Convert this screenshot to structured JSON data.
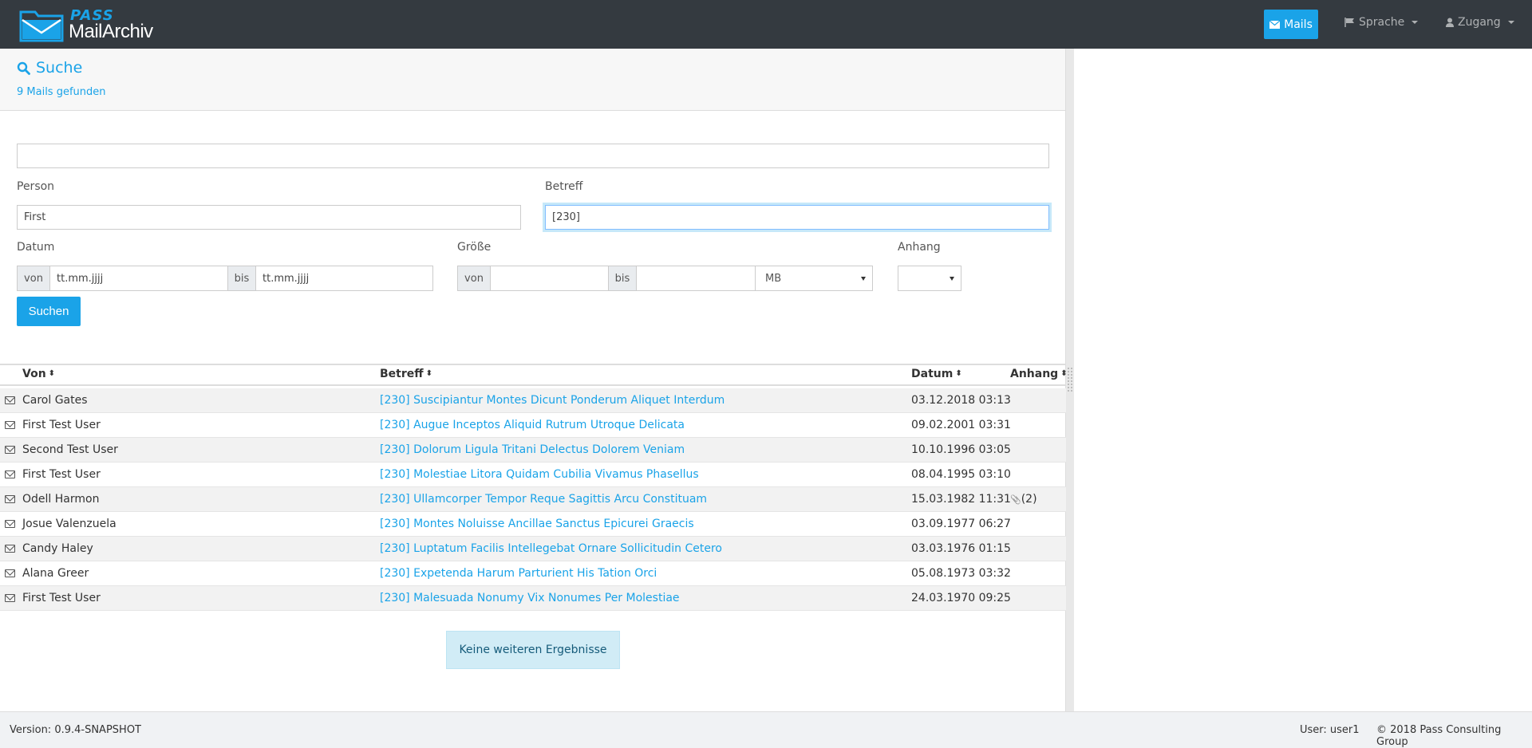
{
  "brand": {
    "top": "PASS",
    "bottom": "MailArchiv"
  },
  "nav": {
    "mails": "Mails",
    "language": "Sprache",
    "access": "Zugang"
  },
  "search": {
    "title": "Suche",
    "found": "9 Mails gefunden",
    "fulltext": "",
    "person_label": "Person",
    "person_value": "First",
    "subject_label": "Betreff",
    "subject_value": "[230]",
    "date_label": "Datum",
    "date_from_addon": "von",
    "date_from_placeholder": "tt.mm.jjjj",
    "date_to_addon": "bis",
    "date_to_placeholder": "tt.mm.jjjj",
    "size_label": "Größe",
    "size_from_addon": "von",
    "size_to_addon": "bis",
    "size_unit": "MB",
    "attachment_label": "Anhang",
    "attachment_value": "",
    "submit": "Suchen"
  },
  "table": {
    "headers": {
      "from": "Von",
      "subject": "Betreff",
      "date": "Datum",
      "attachment": "Anhang"
    },
    "rows": [
      {
        "from": "Carol Gates",
        "subject": "[230] Suscipiantur Montes Dicunt Ponderum Aliquet Interdum",
        "date": "03.12.2018 03:13",
        "attachment": ""
      },
      {
        "from": "First Test User",
        "subject": "[230] Augue Inceptos Aliquid Rutrum Utroque Delicata",
        "date": "09.02.2001 03:31",
        "attachment": ""
      },
      {
        "from": "Second Test User",
        "subject": "[230] Dolorum Ligula Tritani Delectus Dolorem Veniam",
        "date": "10.10.1996 03:05",
        "attachment": ""
      },
      {
        "from": "First Test User",
        "subject": "[230] Molestiae Litora Quidam Cubilia Vivamus Phasellus",
        "date": "08.04.1995 03:10",
        "attachment": ""
      },
      {
        "from": "Odell Harmon",
        "subject": "[230] Ullamcorper Tempor Reque Sagittis Arcu Constituam",
        "date": "15.03.1982 11:31",
        "attachment": "(2)"
      },
      {
        "from": "Josue Valenzuela",
        "subject": "[230] Montes Noluisse Ancillae Sanctus Epicurei Graecis",
        "date": "03.09.1977 06:27",
        "attachment": ""
      },
      {
        "from": "Candy Haley",
        "subject": "[230] Luptatum Facilis Intellegebat Ornare Sollicitudin Cetero",
        "date": "03.03.1976 01:15",
        "attachment": ""
      },
      {
        "from": "Alana Greer",
        "subject": "[230] Expetenda Harum Parturient His Tation Orci",
        "date": "05.08.1973 03:32",
        "attachment": ""
      },
      {
        "from": "First Test User",
        "subject": "[230] Malesuada Nonumy Vix Nonumes Per Molestiae",
        "date": "24.03.1970 09:25",
        "attachment": ""
      }
    ],
    "no_more": "Keine weiteren Ergebnisse"
  },
  "footer": {
    "version": "Version:  0.9.4-SNAPSHOT",
    "user": "User:  user1",
    "copyright": "© 2018 Pass Consulting Group"
  },
  "colors": {
    "accent": "#1aa3e8",
    "navbar": "#343a40"
  }
}
